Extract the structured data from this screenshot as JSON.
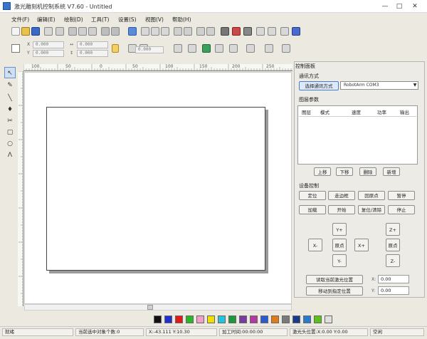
{
  "window": {
    "title": "激光雕刻机控制系统 V7.60 - Untitled",
    "minimize": "—",
    "maximize": "□",
    "close": "✕"
  },
  "menu": [
    "文件(F)",
    "编辑(E)",
    "绘制(D)",
    "工具(T)",
    "设置(S)",
    "视图(V)",
    "帮助(H)"
  ],
  "toolbar2": {
    "x_value": "0.000",
    "y_value": "0.000",
    "w_value": "0.000",
    "h_value": "0.000",
    "angle_value": "0.000"
  },
  "ruler_top_labels": [
    "100",
    "50",
    "0",
    "50",
    "100",
    "150",
    "200",
    "250"
  ],
  "colors": [
    "#111111",
    "#1f2fd0",
    "#e01a1a",
    "#2ab52a",
    "#f2a0c8",
    "#f0e000",
    "#23c3e0",
    "#1a9a3a",
    "#7a3aa0",
    "#b23aa0",
    "#2a5ad0",
    "#e07a1a",
    "#7a7a7a",
    "#1a3a8a",
    "#2a7ad0",
    "#5ac01a",
    "#e0e0e0"
  ],
  "panel": {
    "title": "控制面板",
    "comm_section": "通讯方式",
    "comm_button": "选择通讯方式",
    "port_value": "RobotArm COM3",
    "layer_section": "图层参数",
    "layer_columns": [
      "图层",
      "模式",
      "速度",
      "功率",
      "输出"
    ],
    "layer_buttons": [
      "上移",
      "下移",
      "删除",
      "新增"
    ],
    "device_section": "设备控制",
    "device_buttons": [
      "定位",
      "走边框",
      "回原点",
      "暂停",
      "加载",
      "开始",
      "复位/清除",
      "停止"
    ],
    "jog_up": "Y+",
    "jog_down": "Y-",
    "jog_left": "X-",
    "jog_right": "X+",
    "jog_center": "原点",
    "z_up": "Z+",
    "z_down": "Z-",
    "z_center": "原点",
    "pos_btn1": "读取当前激光位置",
    "pos_btn2": "移动到指定位置",
    "pos_x_label": "X:",
    "pos_x_value": "0.00",
    "pos_y_label": "Y:",
    "pos_y_value": "0.00"
  },
  "status": {
    "ready": "就绪",
    "selected": "当前选中对象个数:0",
    "cursor": "X:-43.111 Y:10.30",
    "time": "加工时间:00:00:00",
    "laser_pos": "激光头位置:X:0.00 Y:0.00",
    "flag": "空闲"
  }
}
